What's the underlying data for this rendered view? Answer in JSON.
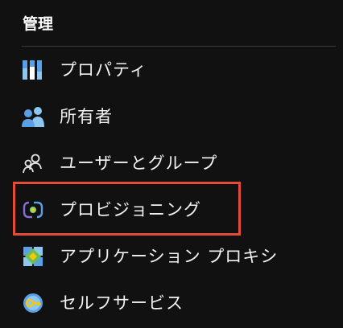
{
  "section": {
    "title": "管理"
  },
  "nav": {
    "items": [
      {
        "label": "プロパティ",
        "icon": "properties-bars-icon"
      },
      {
        "label": "所有者",
        "icon": "owners-people-icon"
      },
      {
        "label": "ユーザーとグループ",
        "icon": "users-groups-icon"
      },
      {
        "label": "プロビジョニング",
        "icon": "provisioning-icon",
        "highlighted": true
      },
      {
        "label": "アプリケーション プロキシ",
        "icon": "application-proxy-icon"
      },
      {
        "label": "セルフサービス",
        "icon": "self-service-icon"
      }
    ]
  },
  "colors": {
    "background": "#111111",
    "text": "#f2f2f2",
    "divider": "#3b3b3b",
    "highlight_border": "#e34c36",
    "icon_blue": "#5aa0e6",
    "icon_purple": "#8a6bd8",
    "icon_yellow": "#f2c811"
  }
}
